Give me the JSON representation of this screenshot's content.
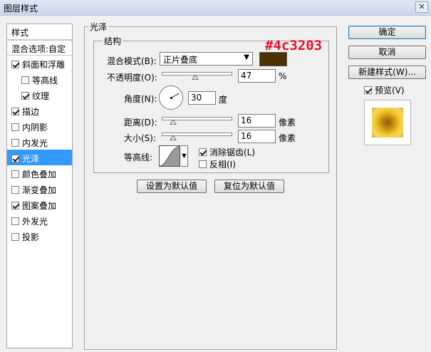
{
  "window": {
    "title": "图层样式",
    "close_icon": "close-icon"
  },
  "sidebar": {
    "header": "样式",
    "blend_options": "混合选项:自定",
    "items": [
      {
        "label": "斜面和浮雕",
        "checked": true,
        "sub": false
      },
      {
        "label": "等高线",
        "checked": false,
        "sub": true
      },
      {
        "label": "纹理",
        "checked": true,
        "sub": true
      },
      {
        "label": "描边",
        "checked": true,
        "sub": false
      },
      {
        "label": "内阴影",
        "checked": false,
        "sub": false
      },
      {
        "label": "内发光",
        "checked": false,
        "sub": false
      },
      {
        "label": "光泽",
        "checked": true,
        "sub": false,
        "selected": true
      },
      {
        "label": "颜色叠加",
        "checked": false,
        "sub": false
      },
      {
        "label": "渐变叠加",
        "checked": false,
        "sub": false
      },
      {
        "label": "图案叠加",
        "checked": true,
        "sub": false
      },
      {
        "label": "外发光",
        "checked": false,
        "sub": false
      },
      {
        "label": "投影",
        "checked": false,
        "sub": false
      }
    ]
  },
  "satin": {
    "group_title": "光泽",
    "structure_title": "结构",
    "blend_mode_label": "混合模式(B):",
    "blend_mode_value": "正片叠底",
    "color": "#4c3203",
    "opacity_label": "不透明度(O):",
    "opacity_value": "47",
    "opacity_unit": "%",
    "opacity_fraction": 0.47,
    "angle_label": "角度(N):",
    "angle_value": "30",
    "angle_unit": "度",
    "distance_label": "距离(D):",
    "distance_value": "16",
    "distance_unit": "像素",
    "distance_fraction": 0.16,
    "size_label": "大小(S):",
    "size_value": "16",
    "size_unit": "像素",
    "size_fraction": 0.16,
    "contour_label": "等高线:",
    "antialias_label": "消除锯齿(L)",
    "antialias_checked": true,
    "invert_label": "反相(I)",
    "invert_checked": false,
    "set_default_button": "设置为默认值",
    "reset_default_button": "复位为默认值"
  },
  "annotation": {
    "text": "#4c3203",
    "color": "#e8112d"
  },
  "actions": {
    "ok": "确定",
    "cancel": "取消",
    "new_style": "新建样式(W)...",
    "preview_label": "预览(V)",
    "preview_checked": true
  }
}
